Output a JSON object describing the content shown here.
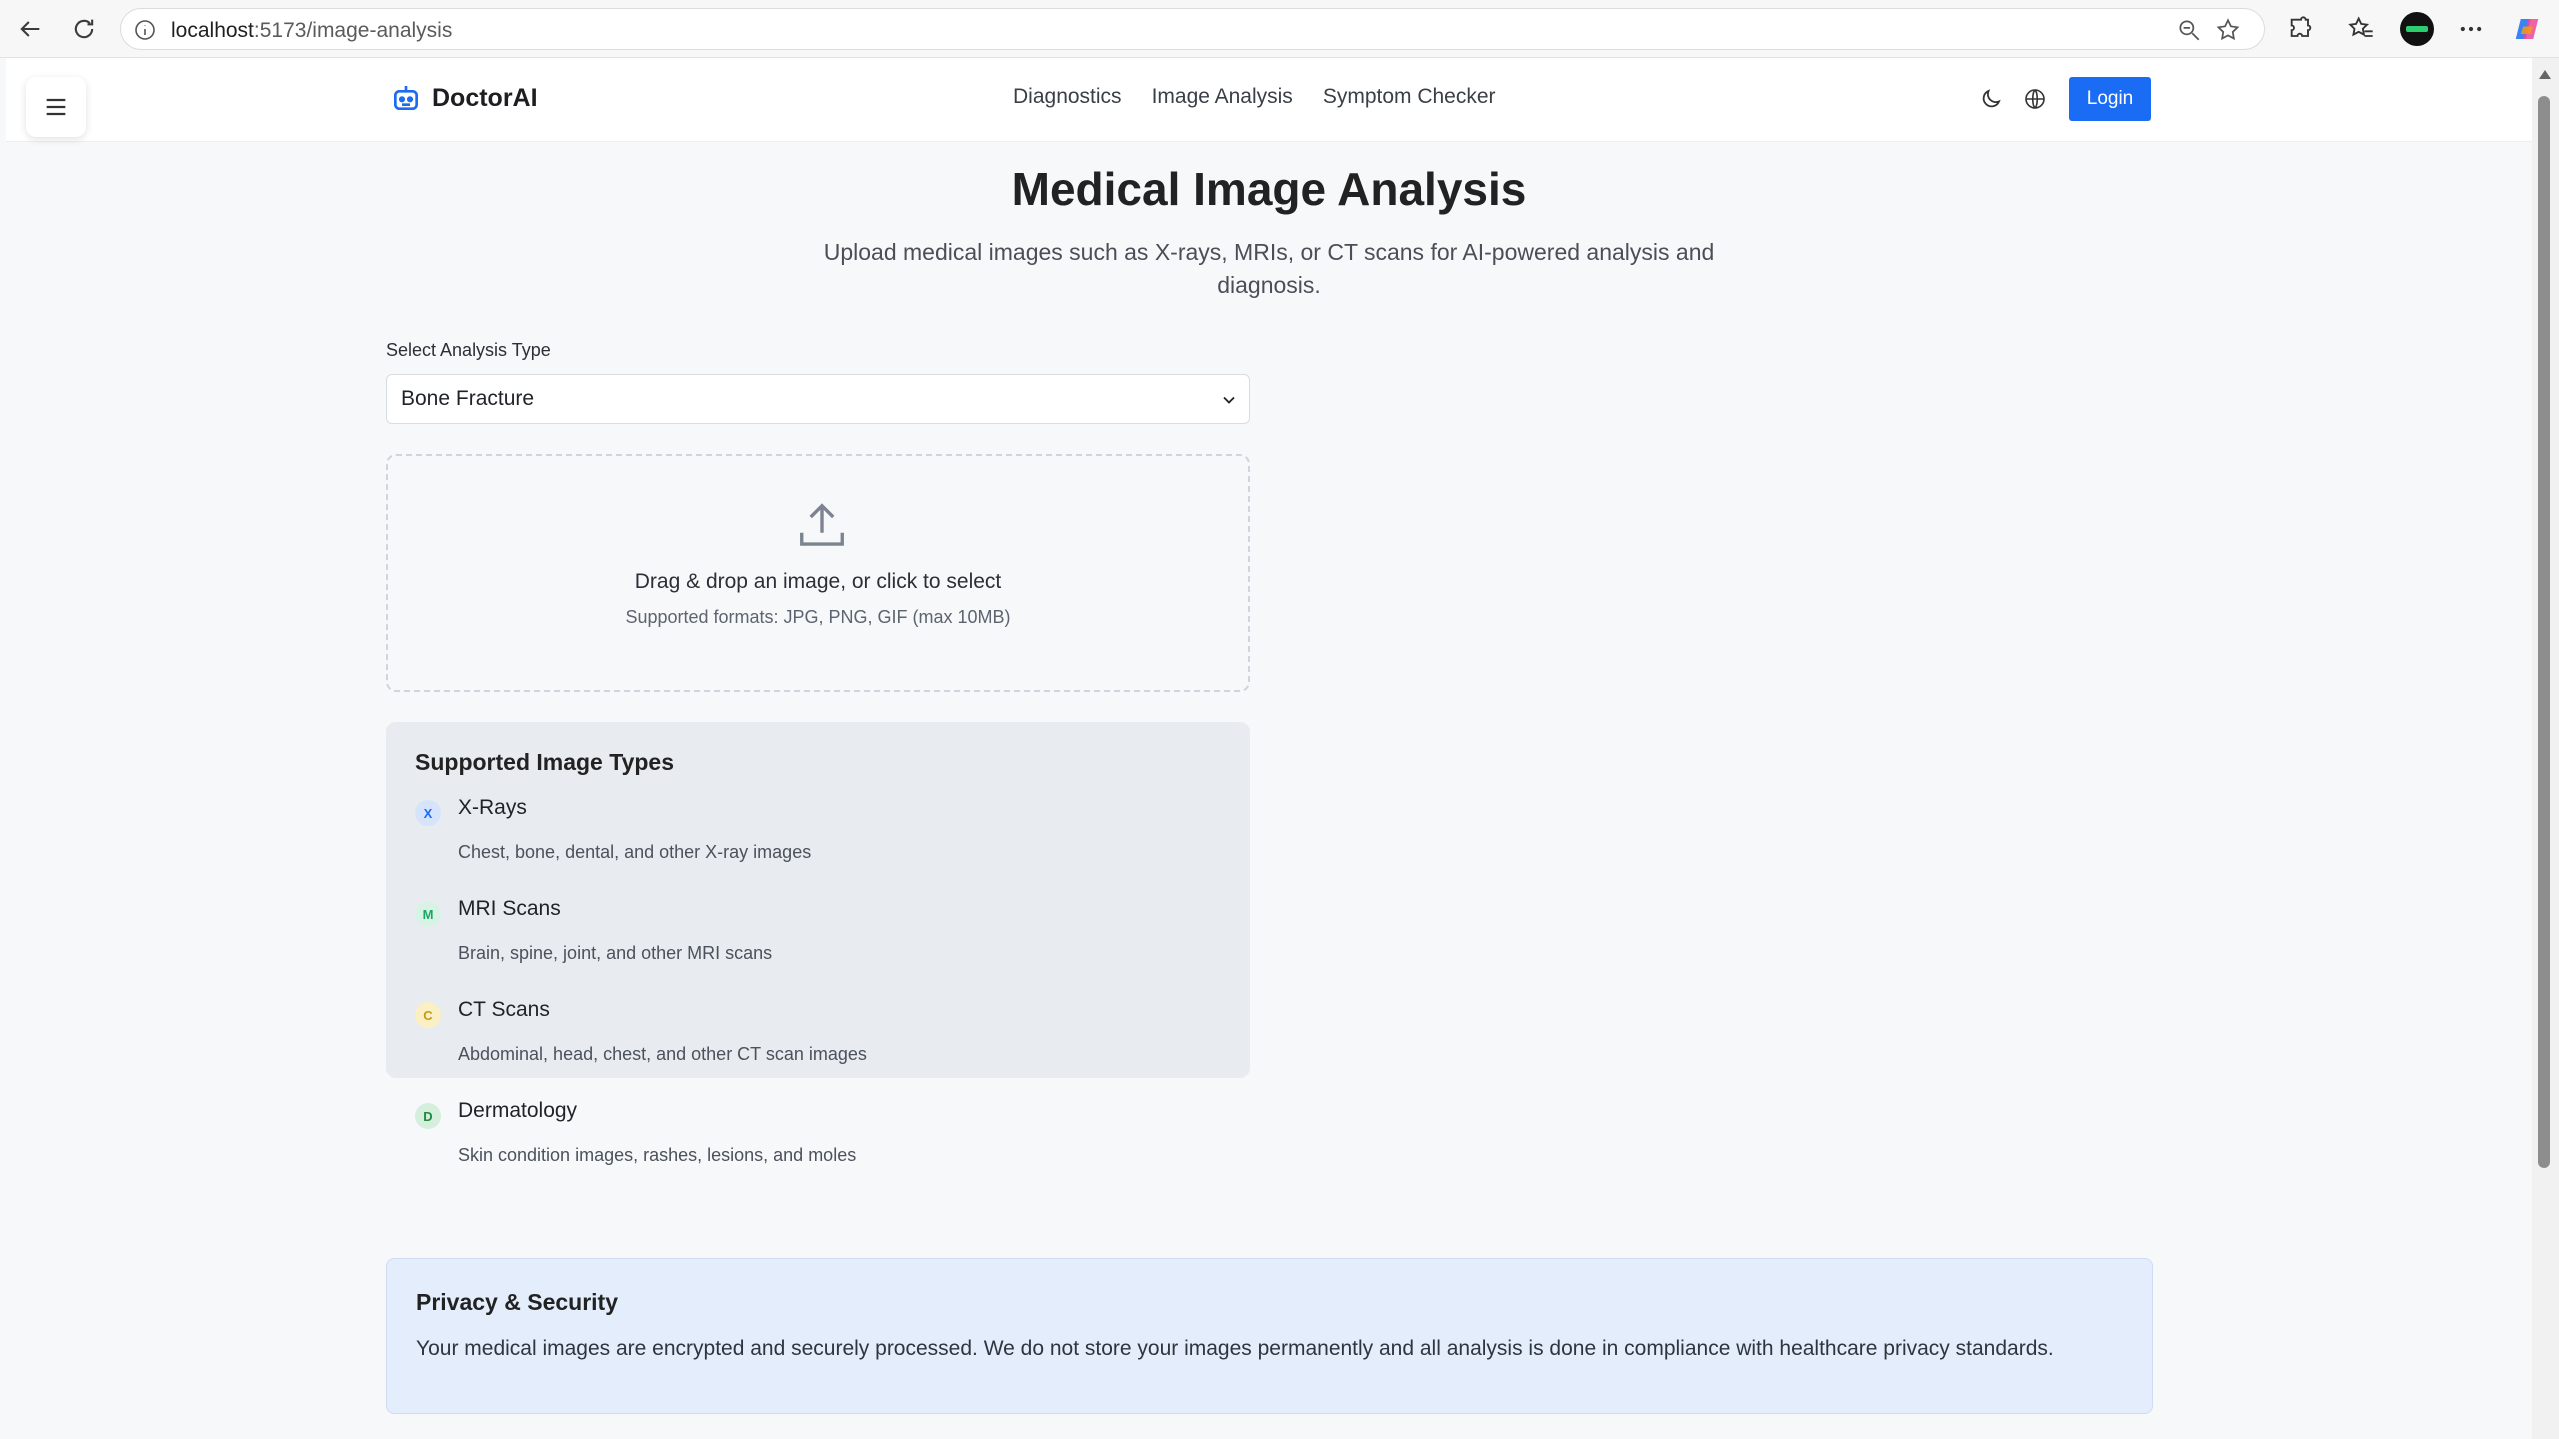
{
  "browser": {
    "url_host": "localhost",
    "url_path": ":5173/image-analysis"
  },
  "header": {
    "brand": "DoctorAI",
    "nav": [
      {
        "label": "Diagnostics"
      },
      {
        "label": "Image Analysis"
      },
      {
        "label": "Symptom Checker"
      }
    ],
    "login_label": "Login"
  },
  "main": {
    "title": "Medical Image Analysis",
    "subtitle": "Upload medical images such as X-rays, MRIs, or CT scans for AI-powered analysis and diagnosis.",
    "analysis_type_label": "Select Analysis Type",
    "analysis_type_value": "Bone Fracture",
    "dropzone": {
      "title": "Drag & drop an image, or click to select",
      "subtitle": "Supported formats: JPG, PNG, GIF (max 10MB)"
    },
    "supported": {
      "heading": "Supported Image Types",
      "items": [
        {
          "badge": "X",
          "name": "X-Rays",
          "desc": "Chest, bone, dental, and other X-ray images",
          "badge_bg": "#d6e4fb",
          "badge_fg": "#1a6cf5"
        },
        {
          "badge": "M",
          "name": "MRI Scans",
          "desc": "Brain, spine, joint, and other MRI scans",
          "badge_bg": "#d8f3e6",
          "badge_fg": "#1aa864"
        },
        {
          "badge": "C",
          "name": "CT Scans",
          "desc": "Abdominal, head, chest, and other CT scan images",
          "badge_bg": "#fbefc4",
          "badge_fg": "#c79a10"
        },
        {
          "badge": "D",
          "name": "Dermatology",
          "desc": "Skin condition images, rashes, lesions, and moles",
          "badge_bg": "#d6efdc",
          "badge_fg": "#1f8a3f"
        }
      ]
    },
    "privacy": {
      "heading": "Privacy & Security",
      "text": "Your medical images are encrypted and securely processed. We do not store your images permanently and all analysis is done in compliance with healthcare privacy standards."
    }
  },
  "colors": {
    "accent": "#1a6cf5",
    "privacy_bg": "#e4edfb",
    "types_bg": "#e8ebef"
  }
}
